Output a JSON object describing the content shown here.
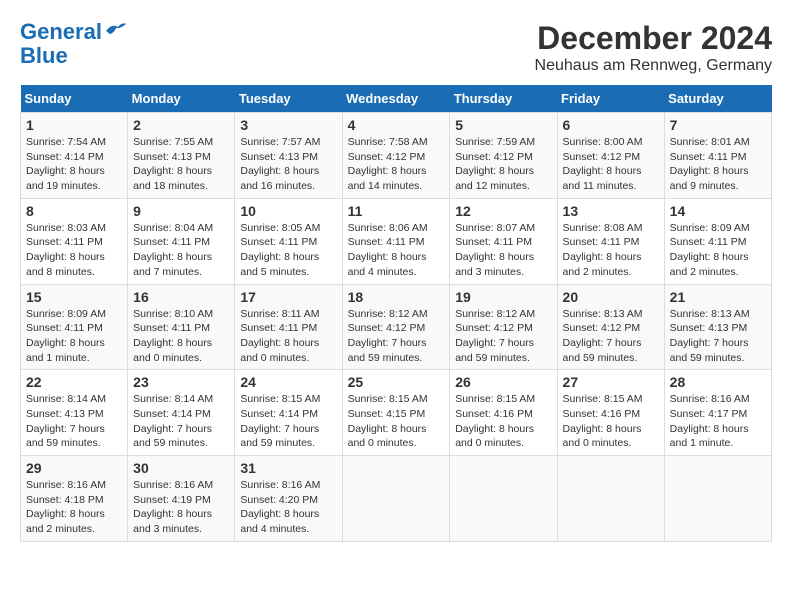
{
  "header": {
    "logo_line1": "General",
    "logo_line2": "Blue",
    "title": "December 2024",
    "subtitle": "Neuhaus am Rennweg, Germany"
  },
  "calendar": {
    "columns": [
      "Sunday",
      "Monday",
      "Tuesday",
      "Wednesday",
      "Thursday",
      "Friday",
      "Saturday"
    ],
    "weeks": [
      [
        {
          "day": "1",
          "sunrise": "Sunrise: 7:54 AM",
          "sunset": "Sunset: 4:14 PM",
          "daylight": "Daylight: 8 hours and 19 minutes."
        },
        {
          "day": "2",
          "sunrise": "Sunrise: 7:55 AM",
          "sunset": "Sunset: 4:13 PM",
          "daylight": "Daylight: 8 hours and 18 minutes."
        },
        {
          "day": "3",
          "sunrise": "Sunrise: 7:57 AM",
          "sunset": "Sunset: 4:13 PM",
          "daylight": "Daylight: 8 hours and 16 minutes."
        },
        {
          "day": "4",
          "sunrise": "Sunrise: 7:58 AM",
          "sunset": "Sunset: 4:12 PM",
          "daylight": "Daylight: 8 hours and 14 minutes."
        },
        {
          "day": "5",
          "sunrise": "Sunrise: 7:59 AM",
          "sunset": "Sunset: 4:12 PM",
          "daylight": "Daylight: 8 hours and 12 minutes."
        },
        {
          "day": "6",
          "sunrise": "Sunrise: 8:00 AM",
          "sunset": "Sunset: 4:12 PM",
          "daylight": "Daylight: 8 hours and 11 minutes."
        },
        {
          "day": "7",
          "sunrise": "Sunrise: 8:01 AM",
          "sunset": "Sunset: 4:11 PM",
          "daylight": "Daylight: 8 hours and 9 minutes."
        }
      ],
      [
        {
          "day": "8",
          "sunrise": "Sunrise: 8:03 AM",
          "sunset": "Sunset: 4:11 PM",
          "daylight": "Daylight: 8 hours and 8 minutes."
        },
        {
          "day": "9",
          "sunrise": "Sunrise: 8:04 AM",
          "sunset": "Sunset: 4:11 PM",
          "daylight": "Daylight: 8 hours and 7 minutes."
        },
        {
          "day": "10",
          "sunrise": "Sunrise: 8:05 AM",
          "sunset": "Sunset: 4:11 PM",
          "daylight": "Daylight: 8 hours and 5 minutes."
        },
        {
          "day": "11",
          "sunrise": "Sunrise: 8:06 AM",
          "sunset": "Sunset: 4:11 PM",
          "daylight": "Daylight: 8 hours and 4 minutes."
        },
        {
          "day": "12",
          "sunrise": "Sunrise: 8:07 AM",
          "sunset": "Sunset: 4:11 PM",
          "daylight": "Daylight: 8 hours and 3 minutes."
        },
        {
          "day": "13",
          "sunrise": "Sunrise: 8:08 AM",
          "sunset": "Sunset: 4:11 PM",
          "daylight": "Daylight: 8 hours and 2 minutes."
        },
        {
          "day": "14",
          "sunrise": "Sunrise: 8:09 AM",
          "sunset": "Sunset: 4:11 PM",
          "daylight": "Daylight: 8 hours and 2 minutes."
        }
      ],
      [
        {
          "day": "15",
          "sunrise": "Sunrise: 8:09 AM",
          "sunset": "Sunset: 4:11 PM",
          "daylight": "Daylight: 8 hours and 1 minute."
        },
        {
          "day": "16",
          "sunrise": "Sunrise: 8:10 AM",
          "sunset": "Sunset: 4:11 PM",
          "daylight": "Daylight: 8 hours and 0 minutes."
        },
        {
          "day": "17",
          "sunrise": "Sunrise: 8:11 AM",
          "sunset": "Sunset: 4:11 PM",
          "daylight": "Daylight: 8 hours and 0 minutes."
        },
        {
          "day": "18",
          "sunrise": "Sunrise: 8:12 AM",
          "sunset": "Sunset: 4:12 PM",
          "daylight": "Daylight: 7 hours and 59 minutes."
        },
        {
          "day": "19",
          "sunrise": "Sunrise: 8:12 AM",
          "sunset": "Sunset: 4:12 PM",
          "daylight": "Daylight: 7 hours and 59 minutes."
        },
        {
          "day": "20",
          "sunrise": "Sunrise: 8:13 AM",
          "sunset": "Sunset: 4:12 PM",
          "daylight": "Daylight: 7 hours and 59 minutes."
        },
        {
          "day": "21",
          "sunrise": "Sunrise: 8:13 AM",
          "sunset": "Sunset: 4:13 PM",
          "daylight": "Daylight: 7 hours and 59 minutes."
        }
      ],
      [
        {
          "day": "22",
          "sunrise": "Sunrise: 8:14 AM",
          "sunset": "Sunset: 4:13 PM",
          "daylight": "Daylight: 7 hours and 59 minutes."
        },
        {
          "day": "23",
          "sunrise": "Sunrise: 8:14 AM",
          "sunset": "Sunset: 4:14 PM",
          "daylight": "Daylight: 7 hours and 59 minutes."
        },
        {
          "day": "24",
          "sunrise": "Sunrise: 8:15 AM",
          "sunset": "Sunset: 4:14 PM",
          "daylight": "Daylight: 7 hours and 59 minutes."
        },
        {
          "day": "25",
          "sunrise": "Sunrise: 8:15 AM",
          "sunset": "Sunset: 4:15 PM",
          "daylight": "Daylight: 8 hours and 0 minutes."
        },
        {
          "day": "26",
          "sunrise": "Sunrise: 8:15 AM",
          "sunset": "Sunset: 4:16 PM",
          "daylight": "Daylight: 8 hours and 0 minutes."
        },
        {
          "day": "27",
          "sunrise": "Sunrise: 8:15 AM",
          "sunset": "Sunset: 4:16 PM",
          "daylight": "Daylight: 8 hours and 0 minutes."
        },
        {
          "day": "28",
          "sunrise": "Sunrise: 8:16 AM",
          "sunset": "Sunset: 4:17 PM",
          "daylight": "Daylight: 8 hours and 1 minute."
        }
      ],
      [
        {
          "day": "29",
          "sunrise": "Sunrise: 8:16 AM",
          "sunset": "Sunset: 4:18 PM",
          "daylight": "Daylight: 8 hours and 2 minutes."
        },
        {
          "day": "30",
          "sunrise": "Sunrise: 8:16 AM",
          "sunset": "Sunset: 4:19 PM",
          "daylight": "Daylight: 8 hours and 3 minutes."
        },
        {
          "day": "31",
          "sunrise": "Sunrise: 8:16 AM",
          "sunset": "Sunset: 4:20 PM",
          "daylight": "Daylight: 8 hours and 4 minutes."
        },
        null,
        null,
        null,
        null
      ]
    ]
  }
}
